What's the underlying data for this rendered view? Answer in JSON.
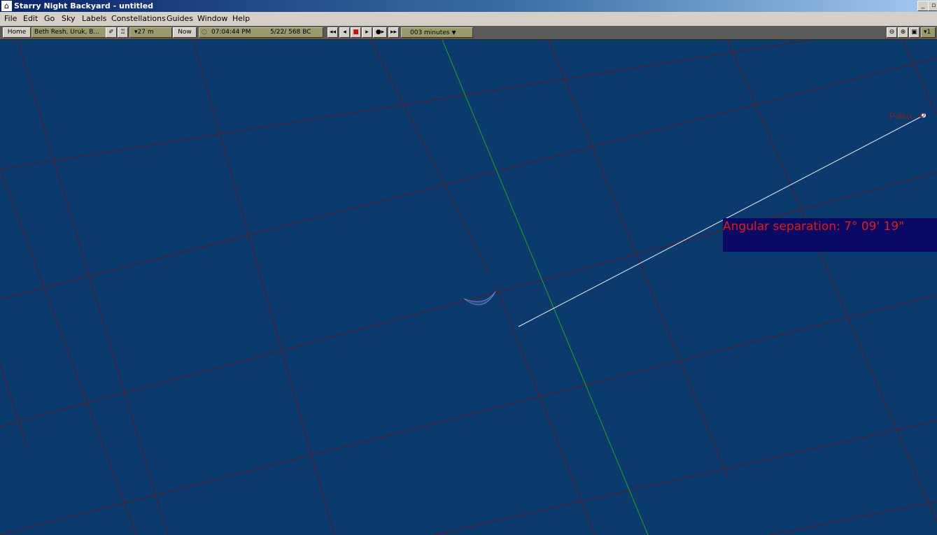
{
  "window": {
    "title": "Starry Night Backyard - untitled",
    "min": "_",
    "close": "▫"
  },
  "menu": [
    {
      "label": "File"
    },
    {
      "label": "Edit"
    },
    {
      "label": "Go"
    },
    {
      "label": "Sky"
    },
    {
      "label": "Labels"
    },
    {
      "label": "Constellations"
    },
    {
      "label": "Guides"
    },
    {
      "label": "Window"
    },
    {
      "label": "Help"
    }
  ],
  "toolbar": {
    "home_label": "Home",
    "location_label": "Beth Resh, Uruk, B...",
    "elevation_label": "▾27 m",
    "now_label": "Now",
    "time_label": "07:04:44 PM",
    "date_label": "5/22/  568 BC",
    "timestep_label": "003 minutes",
    "zoom_field_label": "▾1",
    "icons": {
      "viewpoint": "✐",
      "observer": "♖",
      "clock": "◌",
      "rewind": "◂◂",
      "step_back": "◂",
      "stop": "■",
      "play": "▸",
      "play_fast": "●▸",
      "step_forward": "▸▸",
      "zoom_out": "⊖",
      "zoom_in": "⊕",
      "zoom_fit": "▣"
    }
  },
  "sky": {
    "star_label": "Pollux",
    "star_label_suffix": "P",
    "measurement_text": "Angular separation: 7° 09' 19\"",
    "colors": {
      "background": "#0b3a6c",
      "grid": "#5a1a22",
      "meridian": "#1ea81e",
      "measure_line": "#f0f0f0",
      "label": "#8a1e2a",
      "measurement_text": "#e11a14",
      "measurement_box": "#0a0a66"
    }
  }
}
